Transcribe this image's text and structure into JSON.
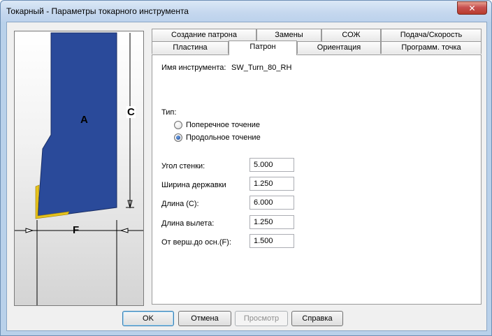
{
  "window": {
    "title": "Токарный - Параметры токарного инструмента",
    "close_glyph": "✕"
  },
  "tabs_row1": [
    "Создание патрона",
    "Замены",
    "СОЖ",
    "Подача/Скорость"
  ],
  "tabs_row2": [
    "Пластина",
    "Патрон",
    "Ориентация",
    "Программ. точка"
  ],
  "active_tab": "Патрон",
  "tool_name": {
    "label": "Имя инструмента:",
    "value": "SW_Turn_80_RH"
  },
  "type_group": {
    "label": "Тип:",
    "options": [
      {
        "label": "Поперечное точение",
        "checked": false
      },
      {
        "label": "Продольное точение",
        "checked": true
      }
    ]
  },
  "params": [
    {
      "label": "Угол стенки:",
      "value": "5.000"
    },
    {
      "label": "Ширина державки",
      "value": "1.250"
    },
    {
      "label": "Длина (C):",
      "value": "6.000"
    },
    {
      "label": "Длина вылета:",
      "value": "1.250"
    },
    {
      "label": "От верш.до осн.(F):",
      "value": "1.500"
    }
  ],
  "preview": {
    "label_a": "A",
    "label_c": "C",
    "label_f": "F",
    "holder_color": "#2a4a9a",
    "insert_color": "#e6c21c"
  },
  "buttons": {
    "ok": "OK",
    "cancel": "Отмена",
    "preview": "Просмотр",
    "help": "Справка"
  }
}
